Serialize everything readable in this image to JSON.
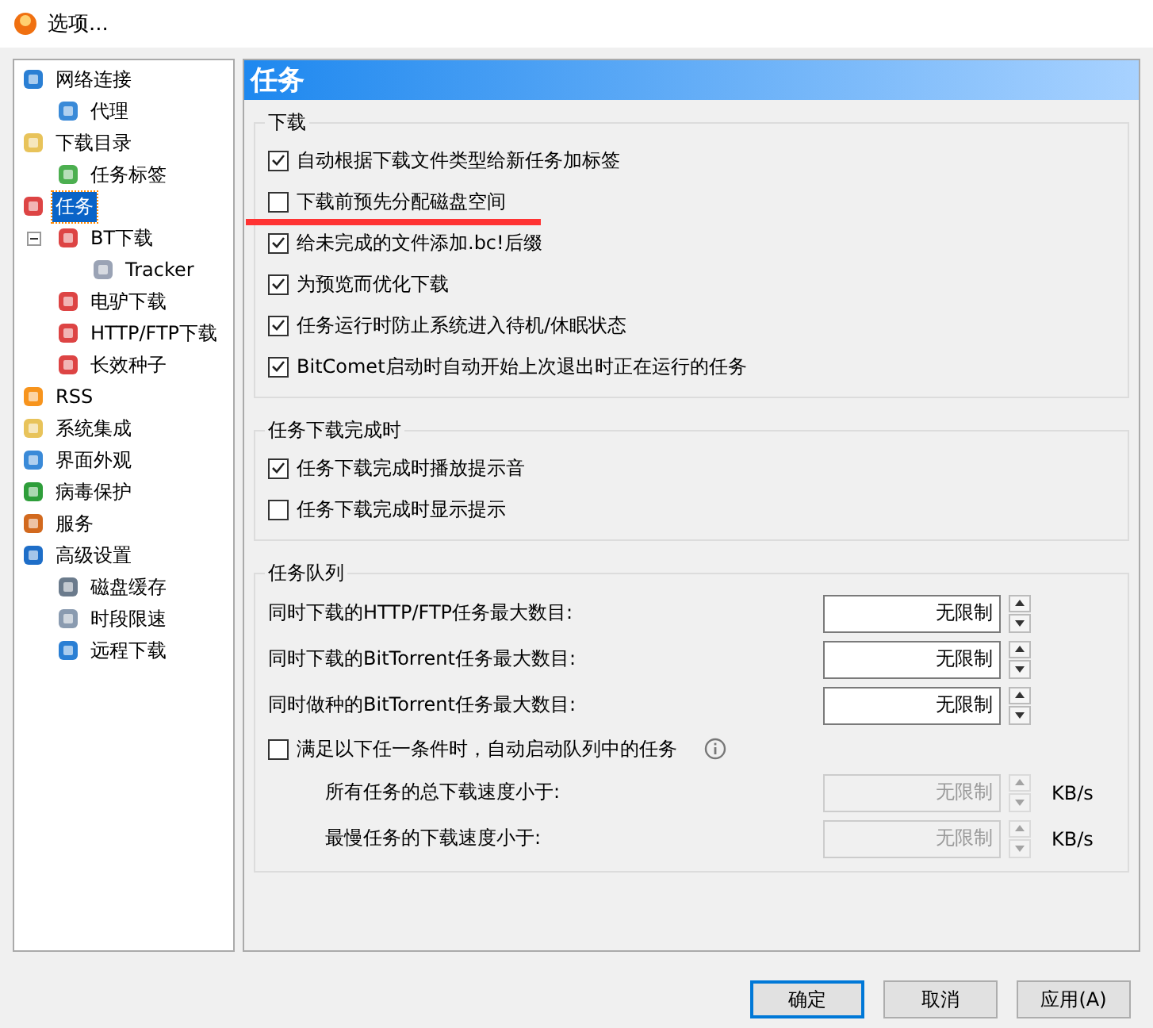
{
  "window": {
    "title": "选项..."
  },
  "tree": [
    {
      "label": "网络连接",
      "selected": false,
      "children": [
        {
          "label": "代理",
          "selected": false
        }
      ]
    },
    {
      "label": "下载目录",
      "selected": false,
      "children": [
        {
          "label": "任务标签",
          "selected": false
        }
      ]
    },
    {
      "label": "任务",
      "selected": true,
      "children": [
        {
          "label": "BT下载",
          "selected": false,
          "expanded": true,
          "children": [
            {
              "label": "Tracker",
              "selected": false
            }
          ]
        },
        {
          "label": "电驴下载",
          "selected": false
        },
        {
          "label": "HTTP/FTP下载",
          "selected": false
        },
        {
          "label": "长效种子",
          "selected": false
        }
      ]
    },
    {
      "label": "RSS",
      "selected": false
    },
    {
      "label": "系统集成",
      "selected": false
    },
    {
      "label": "界面外观",
      "selected": false
    },
    {
      "label": "病毒保护",
      "selected": false
    },
    {
      "label": "服务",
      "selected": false
    },
    {
      "label": "高级设置",
      "selected": false,
      "children": [
        {
          "label": "磁盘缓存",
          "selected": false
        },
        {
          "label": "时段限速",
          "selected": false
        },
        {
          "label": "远程下载",
          "selected": false
        }
      ]
    }
  ],
  "page_title": "任务",
  "groups": [
    {
      "title": "下载",
      "items": [
        {
          "kind": "checkbox",
          "label": "自动根据下载文件类型给新任务加标签",
          "checked": true,
          "highlighted": false
        },
        {
          "kind": "checkbox",
          "label": "下载前预先分配磁盘空间",
          "checked": false,
          "highlighted": true
        },
        {
          "kind": "checkbox",
          "label": "给未完成的文件添加.bc!后缀",
          "checked": true,
          "highlighted": false
        },
        {
          "kind": "checkbox",
          "label": "为预览而优化下载",
          "checked": true,
          "highlighted": false
        },
        {
          "kind": "checkbox",
          "label": "任务运行时防止系统进入待机/休眠状态",
          "checked": true,
          "highlighted": false
        },
        {
          "kind": "checkbox",
          "label": "BitComet启动时自动开始上次退出时正在运行的任务",
          "checked": true,
          "highlighted": false
        }
      ]
    },
    {
      "title": "任务下载完成时",
      "items": [
        {
          "kind": "checkbox",
          "label": "任务下载完成时播放提示音",
          "checked": true,
          "highlighted": false
        },
        {
          "kind": "checkbox",
          "label": "任务下载完成时显示提示",
          "checked": false,
          "highlighted": false
        }
      ]
    },
    {
      "title": "任务队列",
      "items": [
        {
          "kind": "spin",
          "label": "同时下载的HTTP/FTP任务最大数目:",
          "value": "无限制",
          "disabled": false
        },
        {
          "kind": "spin",
          "label": "同时下载的BitTorrent任务最大数目:",
          "value": "无限制",
          "disabled": false
        },
        {
          "kind": "spin",
          "label": "同时做种的BitTorrent任务最大数目:",
          "value": "无限制",
          "disabled": false
        },
        {
          "kind": "checkbox",
          "label": "满足以下任一条件时，自动启动队列中的任务",
          "checked": false,
          "highlighted": false,
          "info": true
        },
        {
          "kind": "spin",
          "label": "所有任务的总下载速度小于:",
          "value": "无限制",
          "disabled": true,
          "unit": "KB/s"
        },
        {
          "kind": "spin",
          "label": "最慢任务的下载速度小于:",
          "value": "无限制",
          "disabled": true,
          "unit": "KB/s"
        }
      ]
    }
  ],
  "buttons": [
    {
      "label": "确定",
      "default": true
    },
    {
      "label": "取消",
      "default": false
    },
    {
      "label": "应用(A)",
      "default": false
    }
  ]
}
